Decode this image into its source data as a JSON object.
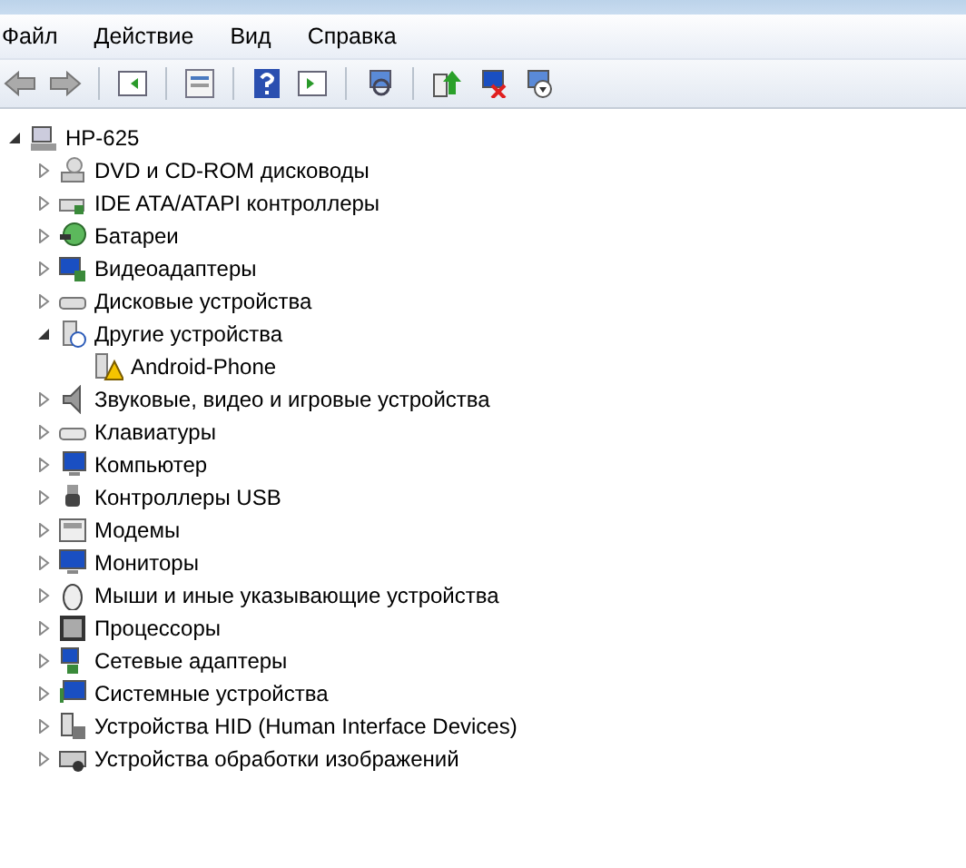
{
  "menu": [
    "Файл",
    "Действие",
    "Вид",
    "Справка"
  ],
  "tree": {
    "label": "HP-625",
    "expanded": true,
    "children": [
      {
        "label": "DVD и CD-ROM дисководы",
        "expanded": false
      },
      {
        "label": "IDE ATA/ATAPI контроллеры",
        "expanded": false
      },
      {
        "label": "Батареи",
        "expanded": false
      },
      {
        "label": "Видеоадаптеры",
        "expanded": false
      },
      {
        "label": "Дисковые устройства",
        "expanded": false
      },
      {
        "label": "Другие устройства",
        "expanded": true,
        "children": [
          {
            "label": "Android-Phone",
            "warning": true
          }
        ]
      },
      {
        "label": "Звуковые, видео и игровые устройства",
        "expanded": false
      },
      {
        "label": "Клавиатуры",
        "expanded": false
      },
      {
        "label": "Компьютер",
        "expanded": false
      },
      {
        "label": "Контроллеры USB",
        "expanded": false
      },
      {
        "label": "Модемы",
        "expanded": false
      },
      {
        "label": "Мониторы",
        "expanded": false
      },
      {
        "label": "Мыши и иные указывающие устройства",
        "expanded": false
      },
      {
        "label": "Процессоры",
        "expanded": false
      },
      {
        "label": "Сетевые адаптеры",
        "expanded": false
      },
      {
        "label": "Системные устройства",
        "expanded": false
      },
      {
        "label": "Устройства HID (Human Interface Devices)",
        "expanded": false
      },
      {
        "label": "Устройства обработки изображений",
        "expanded": false
      }
    ]
  }
}
